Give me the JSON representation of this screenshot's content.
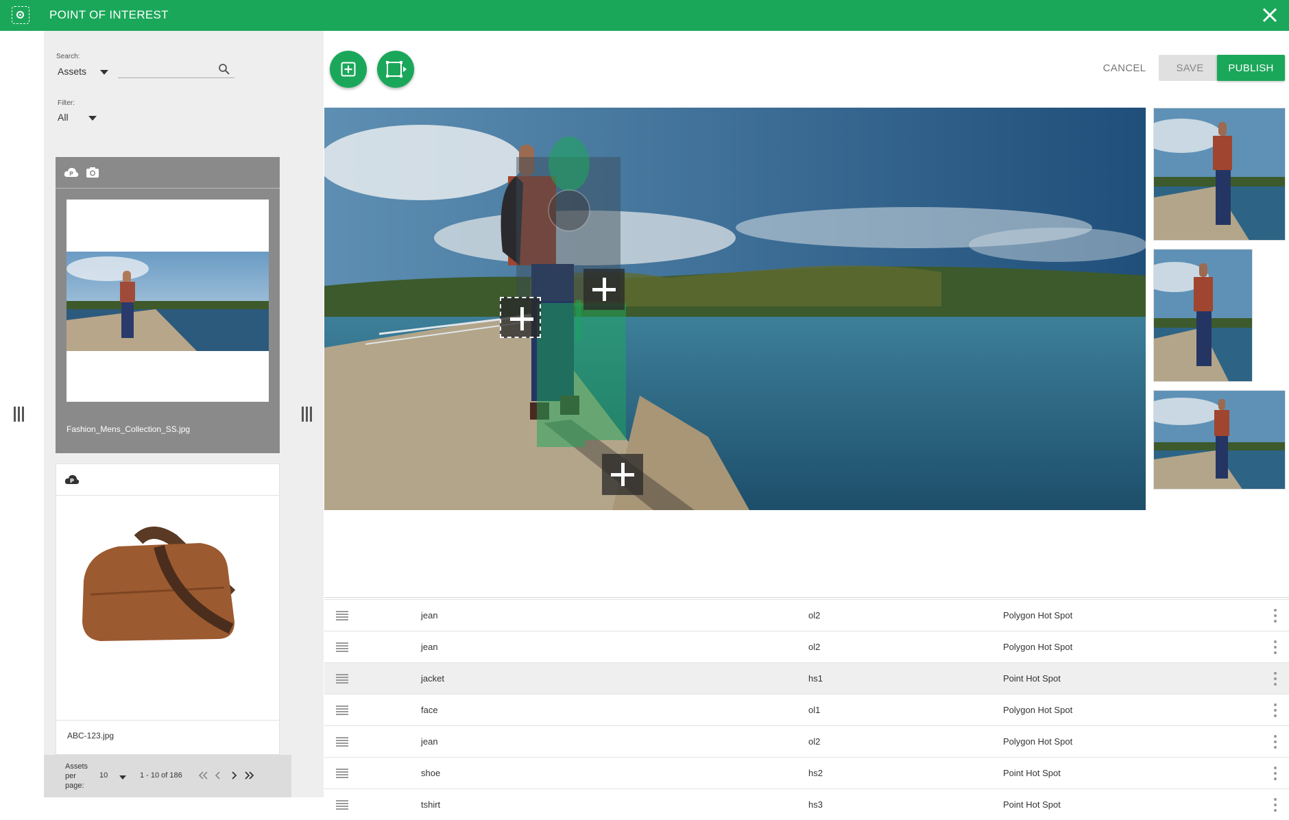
{
  "header": {
    "title": "POINT OF INTEREST",
    "app_icon": "poi-target-icon",
    "close_icon": "close-icon"
  },
  "sidebar": {
    "search_label": "Search:",
    "search_scope": "Assets",
    "search_value": "",
    "filter_label": "Filter:",
    "filter_value": "All",
    "cards": [
      {
        "filename": "Fashion_Mens_Collection_SS.jpg",
        "icons": [
          "cloud-p-icon",
          "camera-icon"
        ]
      },
      {
        "filename": "ABC-123.jpg",
        "icons": [
          "cloud-p-icon"
        ]
      }
    ],
    "pager": {
      "per_page_label_1": "Assets",
      "per_page_label_2": "per",
      "per_page_label_3": "page:",
      "per_page_value": "10",
      "range": "1 - 10 of 186"
    }
  },
  "toolbar": {
    "add_icon": "add-hotspot-icon",
    "polygon_icon": "polygon-select-icon",
    "cancel": "CANCEL",
    "save": "SAVE",
    "publish": "PUBLISH"
  },
  "hotspots": {
    "rows": [
      {
        "name": "jean",
        "id": "ol2",
        "type": "Polygon Hot Spot",
        "selected": false
      },
      {
        "name": "jean",
        "id": "ol2",
        "type": "Polygon Hot Spot",
        "selected": false
      },
      {
        "name": "jacket",
        "id": "hs1",
        "type": "Point Hot Spot",
        "selected": true
      },
      {
        "name": "face",
        "id": "ol1",
        "type": "Polygon Hot Spot",
        "selected": false
      },
      {
        "name": "jean",
        "id": "ol2",
        "type": "Polygon Hot Spot",
        "selected": false
      },
      {
        "name": "shoe",
        "id": "hs2",
        "type": "Point Hot Spot",
        "selected": false
      },
      {
        "name": "tshirt",
        "id": "hs3",
        "type": "Point Hot Spot",
        "selected": false
      }
    ]
  },
  "colors": {
    "brand": "#1ba75a",
    "sidebar": "#eeeeee"
  }
}
